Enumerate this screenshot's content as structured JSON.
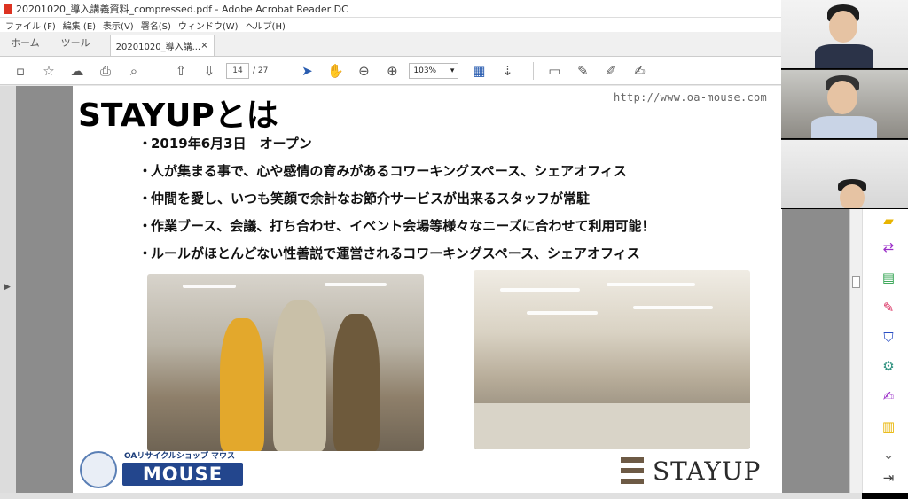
{
  "window": {
    "title": "20201020_導入講義資料_compressed.pdf - Adobe Acrobat Reader DC"
  },
  "menu": [
    "ファイル (F)",
    "編集 (E)",
    "表示(V)",
    "署名(S)",
    "ウィンドウ(W)",
    "ヘルプ(H)"
  ],
  "tabs": {
    "home": "ホーム",
    "tools": "ツール",
    "doc": "20201020_導入講...",
    "doc_close": "×"
  },
  "toolbar": {
    "page_current": "14",
    "page_sep": "/",
    "page_total": "27",
    "zoom": "103%"
  },
  "slide": {
    "url": "http://www.oa-mouse.com",
    "heading": "STAYUPとは",
    "bullets": [
      "2019年6月3日　オープン",
      "人が集まる事で、心や感情の育みがあるコワーキングスペース、シェアオフィス",
      "仲間を愛し、いつも笑顔で余計なお節介サービスが出来るスタッフが常駐",
      "作業ブース、会議、打ち合わせ、イベント会場等様々なニーズに合わせて利用可能！",
      "ルールがほとんどない性善説で運営されるコワーキングスペース、シェアオフィス"
    ],
    "bullet_mark": "・",
    "mouse_small": "OAリサイクルショップ マウス",
    "mouse_big": "MOUSE",
    "stayup_logo": "STAYUP"
  },
  "colors": {
    "accent_tools": "#9b2fc8",
    "mouse_brand": "#23468d",
    "stayup_brand": "#6d5a45"
  }
}
